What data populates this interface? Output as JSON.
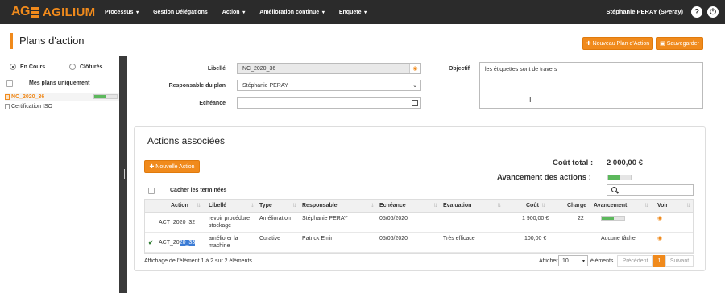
{
  "nav": {
    "logo_ag": "AG",
    "logo_text": "AGILIUM",
    "menu": [
      {
        "label": "Processus",
        "caret": true
      },
      {
        "label": "Gestion Délégations",
        "caret": false
      },
      {
        "label": "Action",
        "caret": true
      },
      {
        "label": "Amélioration continue",
        "caret": true
      },
      {
        "label": "Enquete",
        "caret": true
      }
    ],
    "user": "Stéphanie PERAY (SPeray)",
    "help_glyph": "?",
    "power_glyph": "⏻"
  },
  "header": {
    "title": "Plans d'action",
    "new_plan": "✚ Nouveau Plan d'Action",
    "save": "▣ Sauvegarder"
  },
  "sidebar": {
    "encours": "En Cours",
    "clotures": "Clôturés",
    "mes_plans": "Mes plans uniquement",
    "plans": [
      {
        "name": "NC_2020_36",
        "progress": 0.5
      },
      {
        "name": "Certification ISO",
        "progress": 0
      }
    ]
  },
  "form": {
    "libelle_label": "Libellé",
    "libelle_value": "NC_2020_36",
    "resp_label": "Responsable du plan",
    "resp_value": "Stéphanie PERAY",
    "echeance_label": "Echéance",
    "echeance_value": "",
    "objectif_label": "Objectif",
    "objectif_value": "les étiquettes sont de travers"
  },
  "actions": {
    "title": "Actions associées",
    "cout_label": "Coût total :",
    "cout_value": "2 000,00 €",
    "avancement_label": "Avancement des actions :",
    "avancement_value": 0.55,
    "new_action": "✚ Nouvelle Action",
    "cacher": "Cacher les terminées",
    "columns": [
      "Action",
      "Libellé",
      "Type",
      "Responsable",
      "Echéance",
      "Evaluation",
      "Coût",
      "Charge",
      "Avancement",
      "Voir"
    ],
    "rows": [
      {
        "check": "",
        "action": "ACT_2020_32",
        "libelle_1": "revoir procédure",
        "libelle_2": "stockage",
        "type": "Amélioration",
        "responsable": "Stéphanie PERAY",
        "echeance": "05/06/2020",
        "evaluation": "",
        "cout": "1 900,00 €",
        "charge": "22 j",
        "avancement": "",
        "progress": 0.55
      },
      {
        "check": "✔",
        "action_a": "ACT_20",
        "action_b": "20_33",
        "libelle_1": "améliorer la",
        "libelle_2": "machine",
        "type": "Curative",
        "responsable": "Patrick Emin",
        "echeance": "05/06/2020",
        "evaluation": "Très efficace",
        "cout": "100,00 €",
        "charge": "",
        "avancement": "Aucune tâche"
      }
    ],
    "footer": "Affichage de l'élément 1 à 2 sur 2 éléments",
    "afficher": "Afficher",
    "page_size": "10",
    "elements": "éléments",
    "prev": "Précédent",
    "page": "1",
    "next": "Suivant"
  },
  "colors": {
    "accent": "#f08a1c",
    "nav_bg": "#2b2b2b",
    "progress": "#5cb85c"
  }
}
